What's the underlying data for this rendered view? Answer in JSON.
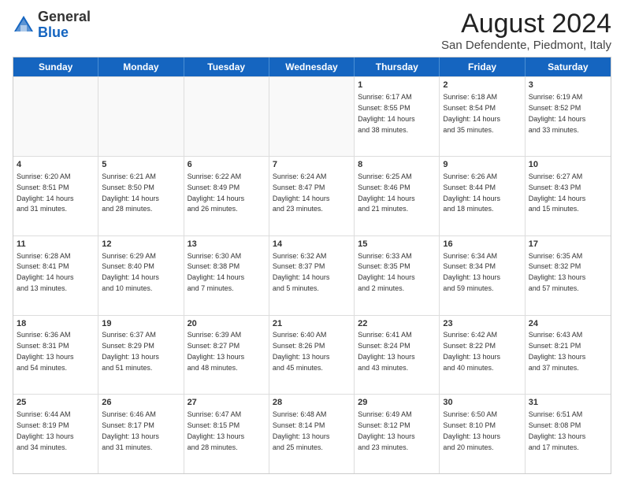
{
  "header": {
    "logo_general": "General",
    "logo_blue": "Blue",
    "month_title": "August 2024",
    "location": "San Defendente, Piedmont, Italy"
  },
  "days_of_week": [
    "Sunday",
    "Monday",
    "Tuesday",
    "Wednesday",
    "Thursday",
    "Friday",
    "Saturday"
  ],
  "weeks": [
    [
      {
        "day": "",
        "info": "",
        "empty": true
      },
      {
        "day": "",
        "info": "",
        "empty": true
      },
      {
        "day": "",
        "info": "",
        "empty": true
      },
      {
        "day": "",
        "info": "",
        "empty": true
      },
      {
        "day": "1",
        "info": "Sunrise: 6:17 AM\nSunset: 8:55 PM\nDaylight: 14 hours\nand 38 minutes."
      },
      {
        "day": "2",
        "info": "Sunrise: 6:18 AM\nSunset: 8:54 PM\nDaylight: 14 hours\nand 35 minutes."
      },
      {
        "day": "3",
        "info": "Sunrise: 6:19 AM\nSunset: 8:52 PM\nDaylight: 14 hours\nand 33 minutes."
      }
    ],
    [
      {
        "day": "4",
        "info": "Sunrise: 6:20 AM\nSunset: 8:51 PM\nDaylight: 14 hours\nand 31 minutes."
      },
      {
        "day": "5",
        "info": "Sunrise: 6:21 AM\nSunset: 8:50 PM\nDaylight: 14 hours\nand 28 minutes."
      },
      {
        "day": "6",
        "info": "Sunrise: 6:22 AM\nSunset: 8:49 PM\nDaylight: 14 hours\nand 26 minutes."
      },
      {
        "day": "7",
        "info": "Sunrise: 6:24 AM\nSunset: 8:47 PM\nDaylight: 14 hours\nand 23 minutes."
      },
      {
        "day": "8",
        "info": "Sunrise: 6:25 AM\nSunset: 8:46 PM\nDaylight: 14 hours\nand 21 minutes."
      },
      {
        "day": "9",
        "info": "Sunrise: 6:26 AM\nSunset: 8:44 PM\nDaylight: 14 hours\nand 18 minutes."
      },
      {
        "day": "10",
        "info": "Sunrise: 6:27 AM\nSunset: 8:43 PM\nDaylight: 14 hours\nand 15 minutes."
      }
    ],
    [
      {
        "day": "11",
        "info": "Sunrise: 6:28 AM\nSunset: 8:41 PM\nDaylight: 14 hours\nand 13 minutes."
      },
      {
        "day": "12",
        "info": "Sunrise: 6:29 AM\nSunset: 8:40 PM\nDaylight: 14 hours\nand 10 minutes."
      },
      {
        "day": "13",
        "info": "Sunrise: 6:30 AM\nSunset: 8:38 PM\nDaylight: 14 hours\nand 7 minutes."
      },
      {
        "day": "14",
        "info": "Sunrise: 6:32 AM\nSunset: 8:37 PM\nDaylight: 14 hours\nand 5 minutes."
      },
      {
        "day": "15",
        "info": "Sunrise: 6:33 AM\nSunset: 8:35 PM\nDaylight: 14 hours\nand 2 minutes."
      },
      {
        "day": "16",
        "info": "Sunrise: 6:34 AM\nSunset: 8:34 PM\nDaylight: 13 hours\nand 59 minutes."
      },
      {
        "day": "17",
        "info": "Sunrise: 6:35 AM\nSunset: 8:32 PM\nDaylight: 13 hours\nand 57 minutes."
      }
    ],
    [
      {
        "day": "18",
        "info": "Sunrise: 6:36 AM\nSunset: 8:31 PM\nDaylight: 13 hours\nand 54 minutes."
      },
      {
        "day": "19",
        "info": "Sunrise: 6:37 AM\nSunset: 8:29 PM\nDaylight: 13 hours\nand 51 minutes."
      },
      {
        "day": "20",
        "info": "Sunrise: 6:39 AM\nSunset: 8:27 PM\nDaylight: 13 hours\nand 48 minutes."
      },
      {
        "day": "21",
        "info": "Sunrise: 6:40 AM\nSunset: 8:26 PM\nDaylight: 13 hours\nand 45 minutes."
      },
      {
        "day": "22",
        "info": "Sunrise: 6:41 AM\nSunset: 8:24 PM\nDaylight: 13 hours\nand 43 minutes."
      },
      {
        "day": "23",
        "info": "Sunrise: 6:42 AM\nSunset: 8:22 PM\nDaylight: 13 hours\nand 40 minutes."
      },
      {
        "day": "24",
        "info": "Sunrise: 6:43 AM\nSunset: 8:21 PM\nDaylight: 13 hours\nand 37 minutes."
      }
    ],
    [
      {
        "day": "25",
        "info": "Sunrise: 6:44 AM\nSunset: 8:19 PM\nDaylight: 13 hours\nand 34 minutes."
      },
      {
        "day": "26",
        "info": "Sunrise: 6:46 AM\nSunset: 8:17 PM\nDaylight: 13 hours\nand 31 minutes."
      },
      {
        "day": "27",
        "info": "Sunrise: 6:47 AM\nSunset: 8:15 PM\nDaylight: 13 hours\nand 28 minutes."
      },
      {
        "day": "28",
        "info": "Sunrise: 6:48 AM\nSunset: 8:14 PM\nDaylight: 13 hours\nand 25 minutes."
      },
      {
        "day": "29",
        "info": "Sunrise: 6:49 AM\nSunset: 8:12 PM\nDaylight: 13 hours\nand 23 minutes."
      },
      {
        "day": "30",
        "info": "Sunrise: 6:50 AM\nSunset: 8:10 PM\nDaylight: 13 hours\nand 20 minutes."
      },
      {
        "day": "31",
        "info": "Sunrise: 6:51 AM\nSunset: 8:08 PM\nDaylight: 13 hours\nand 17 minutes."
      }
    ]
  ]
}
